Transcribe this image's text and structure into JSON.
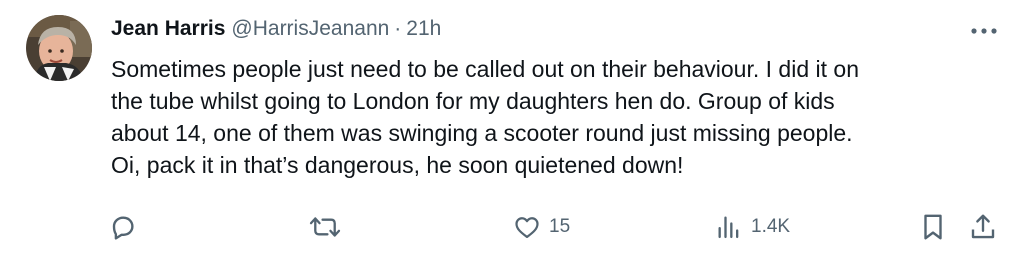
{
  "tweet": {
    "author_name": "Jean Harris",
    "handle": "@HarrisJeanann",
    "separator": "·",
    "time": "21h",
    "text": "Sometimes people just need to be called out on their behaviour. I did it on\nthe tube whilst going to London for my daughters hen do. Group of kids\nabout 14, one of them was swinging a scooter round just missing people.\nOi, pack it in that’s  dangerous, he soon quietened down!"
  },
  "actions": {
    "reply_icon": "reply-icon",
    "retweet_icon": "retweet-icon",
    "like_icon": "heart-icon",
    "like_count": "15",
    "views_icon": "views-icon",
    "views_count": "1.4K",
    "bookmark_icon": "bookmark-icon",
    "share_icon": "share-icon"
  },
  "colors": {
    "text": "#0f1419",
    "secondary": "#536471",
    "background": "#ffffff"
  }
}
